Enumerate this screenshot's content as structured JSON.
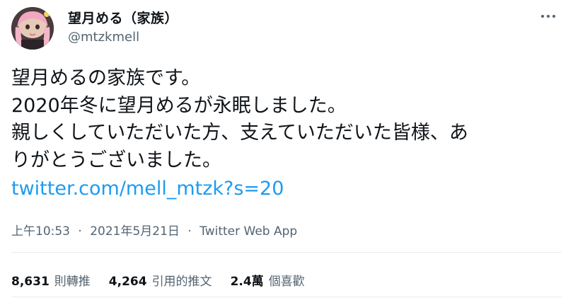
{
  "author": {
    "display_name": "望月める（家族）",
    "handle": "@mtzkmell",
    "avatar_icon": "profile-photo"
  },
  "tweet": {
    "lines": [
      "望月めるの家族です。",
      "2020年冬に望月めるが永眠しました。",
      "親しくしていただいた方、支えていただいた皆様、あ",
      "りがとうございました。"
    ],
    "link": "twitter.com/mell_mtzk?s=20"
  },
  "meta": {
    "time": "上午10:53",
    "separator": "·",
    "date": "2021年5月21日",
    "source": "Twitter Web App"
  },
  "stats": [
    {
      "value": "8,631",
      "label": "則轉推"
    },
    {
      "value": "4,264",
      "label": "引用的推文"
    },
    {
      "value": "2.4萬",
      "label": "個喜歡"
    }
  ],
  "colors": {
    "link": "#1d9bf0",
    "secondary_text": "#536471",
    "primary_text": "#0f1419",
    "divider": "#e6ecf0"
  }
}
